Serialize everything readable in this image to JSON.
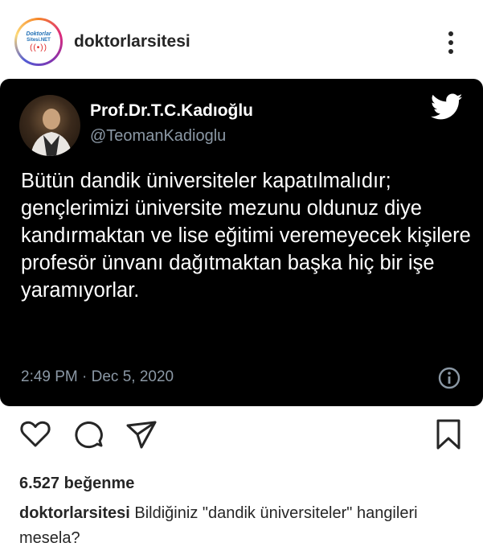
{
  "post": {
    "username": "doktorlarsitesi",
    "avatar_logo": {
      "line1": "Doktorlar",
      "line2": "Sitesi.NET",
      "wave": "((•))"
    },
    "more_icon": "more-vertical-icon"
  },
  "tweet": {
    "display_name": "Prof.Dr.T.C.Kadıoğlu",
    "handle": "@TeomanKadioglu",
    "text": "Bütün dandik üniversiteler kapatılmalıdır; gençlerimizi üniversite mezunu oldunuz diye kandırmaktan ve lise eğitimi veremeyecek kişilere profesör ünvanı dağıtmaktan başka hiç bir işe yaramıyorlar.",
    "timestamp": "2:49 PM · Dec 5, 2020",
    "colors": {
      "background": "#000000",
      "text": "#ffffff",
      "secondary": "#8b98a5"
    }
  },
  "actions": {
    "like_icon": "heart-icon",
    "comment_icon": "comment-icon",
    "share_icon": "send-icon",
    "save_icon": "bookmark-icon"
  },
  "likes": "6.527 beğenme",
  "caption": {
    "username": "doktorlarsitesi",
    "text": "Bildiğiniz \"dandik üniversiteler\" hangileri mesela?"
  }
}
